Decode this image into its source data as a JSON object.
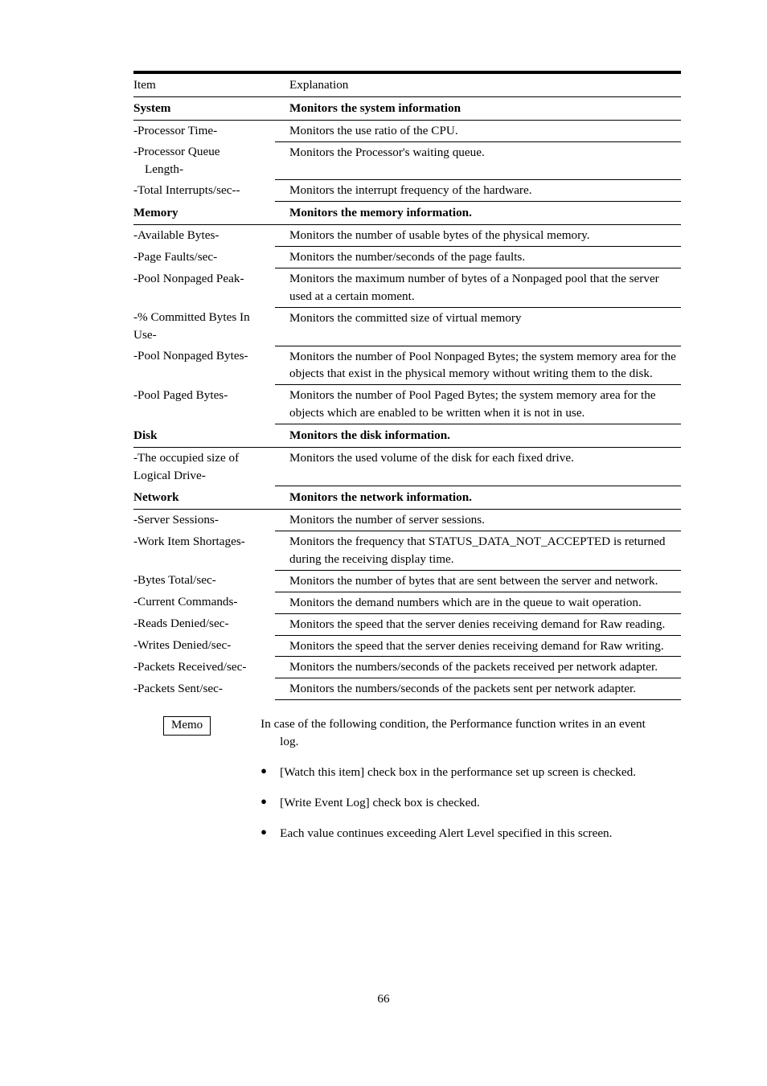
{
  "page": {
    "number": "66"
  },
  "table": {
    "headers": {
      "item": "Item",
      "explanation": "Explanation"
    },
    "rows": [
      {
        "kind": "section",
        "item": "System",
        "explanation": "Monitors the system information"
      },
      {
        "kind": "data",
        "item": "-Processor Time-",
        "explanation": "Monitors the use ratio of the CPU."
      },
      {
        "kind": "data",
        "item": "-Processor Queue",
        "item_cont": "Length-",
        "explanation": "Monitors the Processor's waiting queue."
      },
      {
        "kind": "data",
        "item": "-Total Interrupts/sec--",
        "explanation": "Monitors the interrupt frequency of the hardware."
      },
      {
        "kind": "section",
        "item": "Memory",
        "explanation": "Monitors the memory information."
      },
      {
        "kind": "data",
        "item": "-Available Bytes-",
        "explanation": "Monitors the number of usable bytes of the physical memory."
      },
      {
        "kind": "data",
        "item": "-Page Faults/sec-",
        "explanation": "Monitors the number/seconds of the page faults."
      },
      {
        "kind": "data",
        "item": "-Pool Nonpaged Peak-",
        "explanation": "Monitors the maximum number of bytes of a Nonpaged pool that the server used at a certain moment."
      },
      {
        "kind": "data",
        "item": "-% Committed Bytes In",
        "item_cont": "Use-",
        "item_justify": true,
        "explanation": "Monitors the committed size of virtual memory"
      },
      {
        "kind": "data",
        "item": "-Pool Nonpaged Bytes-",
        "explanation": "Monitors the number of Pool Nonpaged Bytes; the system memory area for the objects that exist in the physical memory without writing them to the disk."
      },
      {
        "kind": "data",
        "item": "-Pool Paged Bytes-",
        "explanation": "Monitors the number of Pool Paged Bytes; the system memory area for the objects which are enabled to be written when it is not in use."
      },
      {
        "kind": "section",
        "item": "Disk",
        "explanation": "Monitors the disk information."
      },
      {
        "kind": "data",
        "item": "-The occupied size of",
        "item_cont": "Logical Drive-",
        "item_justify": true,
        "explanation": "Monitors the used volume of the disk for each fixed drive."
      },
      {
        "kind": "section",
        "item": "Network",
        "explanation": "Monitors the network information."
      },
      {
        "kind": "data",
        "item": "-Server Sessions-",
        "explanation": "Monitors the number of server sessions."
      },
      {
        "kind": "data",
        "item": "-Work Item Shortages-",
        "explanation": "Monitors the frequency that STATUS_DATA_NOT_ACCEPTED is returned during the receiving display time."
      },
      {
        "kind": "data",
        "item": "-Bytes Total/sec-",
        "explanation": "Monitors the number of bytes that are sent between the server and network."
      },
      {
        "kind": "data",
        "item": "-Current Commands-",
        "explanation": "Monitors the demand numbers which are in the queue to wait operation."
      },
      {
        "kind": "data",
        "item": "-Reads Denied/sec-",
        "explanation": "Monitors the speed that the server denies receiving demand for Raw reading."
      },
      {
        "kind": "data",
        "item": "-Writes Denied/sec-",
        "explanation": "Monitors the speed that the server denies receiving demand for Raw writing."
      },
      {
        "kind": "data",
        "item": "-Packets Received/sec-",
        "explanation": "Monitors the numbers/seconds of the packets received per network adapter."
      },
      {
        "kind": "data",
        "item": "-Packets Sent/sec-",
        "explanation": "Monitors the numbers/seconds of the packets sent per network adapter."
      }
    ]
  },
  "memo": {
    "label": "Memo",
    "intro": "In case of the following condition, the Performance function writes in an event",
    "intro_cont": "log.",
    "bullet_glyph": "●",
    "bullets": [
      "[Watch this item] check box in the performance set up screen is checked.",
      "[Write Event Log] check box is checked.",
      "Each value continues exceeding Alert Level specified in this screen."
    ]
  }
}
